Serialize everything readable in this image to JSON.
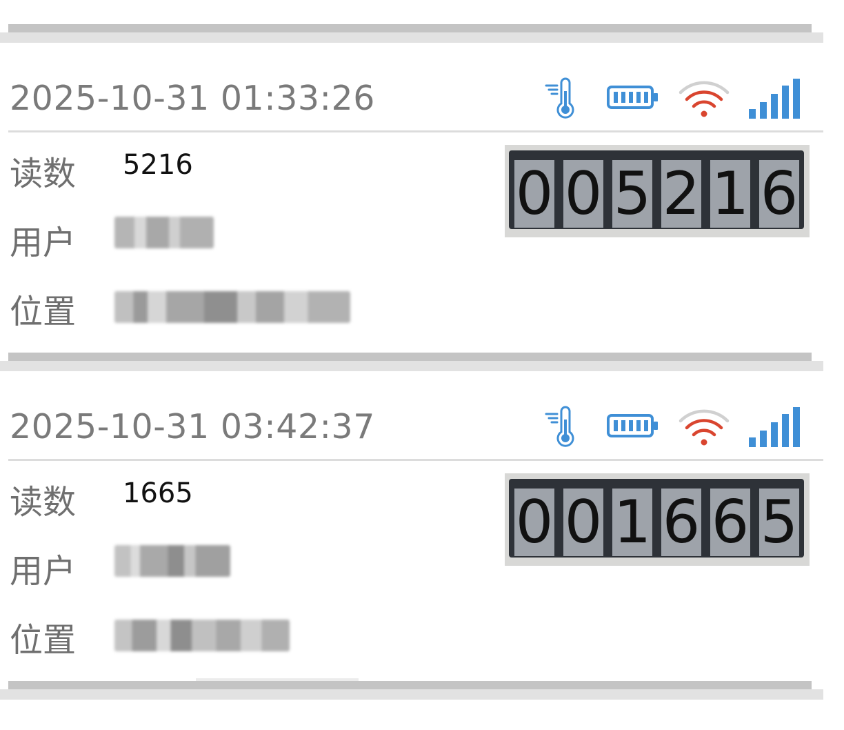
{
  "records": [
    {
      "timestamp": "2025-10-31 01:33:26",
      "reading_label": "读数",
      "reading_value": "5216",
      "user_label": "用户",
      "location_label": "位置",
      "meter_digits": [
        "0",
        "0",
        "5",
        "2",
        "1",
        "6"
      ]
    },
    {
      "timestamp": "2025-10-31 03:42:37",
      "reading_label": "读数",
      "reading_value": "1665",
      "user_label": "用户",
      "location_label": "位置",
      "meter_digits": [
        "0",
        "0",
        "1",
        "6",
        "6",
        "5"
      ]
    }
  ],
  "status_icons": [
    "thermometer-icon",
    "battery-icon",
    "wifi-icon",
    "cell-signal-icon"
  ],
  "colors": {
    "icon_blue": "#3f8fd6",
    "wifi_red": "#d9452f",
    "wifi_gray": "#d0d0d0",
    "timestamp_gray": "#7a7a7a",
    "divider_dark": "#c4c4c4",
    "divider_light": "#e2e2e2"
  }
}
